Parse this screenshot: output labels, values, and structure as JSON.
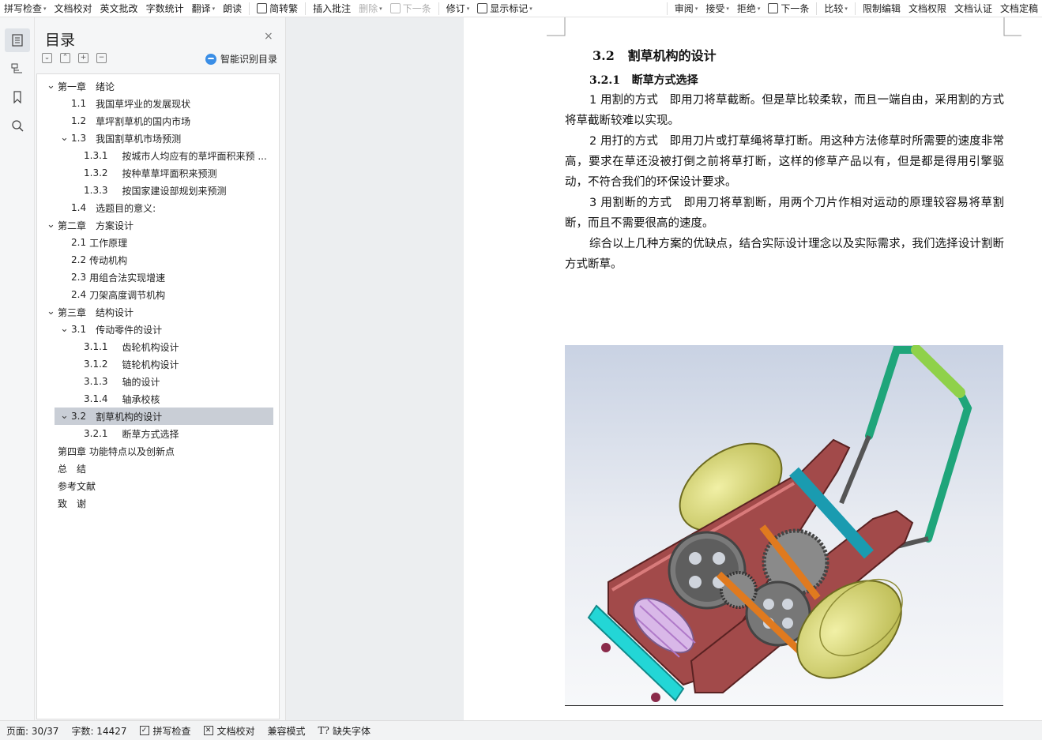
{
  "ribbon": {
    "items": [
      {
        "label": "拼写检查",
        "caret": true,
        "disabled": false
      },
      {
        "label": "文档校对",
        "caret": false,
        "disabled": false
      },
      {
        "label": "英文批改",
        "caret": false,
        "disabled": false
      },
      {
        "label": "字数统计",
        "caret": false,
        "disabled": false
      },
      {
        "label": "翻译",
        "caret": true,
        "disabled": false
      },
      {
        "label": "朗读",
        "caret": false,
        "disabled": false
      },
      {
        "label": "简转繁",
        "caret": false,
        "disabled": false
      },
      {
        "label": "插入批注",
        "caret": false,
        "disabled": false
      },
      {
        "label": "删除",
        "caret": true,
        "disabled": true
      },
      {
        "label": "下一条",
        "caret": false,
        "disabled": true
      },
      {
        "label": "修订",
        "caret": true,
        "disabled": false
      },
      {
        "label": "显示标记",
        "caret": true,
        "disabled": false
      },
      {
        "label": "审阅",
        "caret": true,
        "disabled": false
      },
      {
        "label": "接受",
        "caret": true,
        "disabled": false
      },
      {
        "label": "拒绝",
        "caret": true,
        "disabled": false
      },
      {
        "label": "下一条",
        "caret": false,
        "disabled": false
      },
      {
        "label": "比较",
        "caret": true,
        "disabled": false
      },
      {
        "label": "限制编辑",
        "caret": false,
        "disabled": false
      },
      {
        "label": "文档权限",
        "caret": false,
        "disabled": false
      },
      {
        "label": "文档认证",
        "caret": false,
        "disabled": false
      },
      {
        "label": "文档定稿",
        "caret": false,
        "disabled": false
      }
    ]
  },
  "rail": {
    "icons": [
      "toc-icon",
      "outline-icon",
      "bookmark-icon",
      "search-icon"
    ]
  },
  "toc": {
    "title": "目录",
    "close": "×",
    "tools": [
      "expand-icon",
      "collapse-icon",
      "add-icon",
      "remove-icon"
    ],
    "smart_label": "智能识别目录",
    "items": [
      {
        "num": "第一章",
        "text": "绪论",
        "level": 0,
        "arrow": true,
        "selected": false
      },
      {
        "num": "1.1",
        "text": "我国草坪业的发展现状",
        "level": 1,
        "arrow": false,
        "selected": false
      },
      {
        "num": "1.2",
        "text": "草坪割草机的国内市场",
        "level": 1,
        "arrow": false,
        "selected": false
      },
      {
        "num": "1.3",
        "text": "我国割草机市场预测",
        "level": 1,
        "arrow": true,
        "selected": false
      },
      {
        "num": "1.3.1",
        "text": "按城市人均应有的草坪面积来预 ...",
        "level": 2,
        "arrow": false,
        "selected": false
      },
      {
        "num": "1.3.2",
        "text": "按种草草坪面积来预测",
        "level": 2,
        "arrow": false,
        "selected": false
      },
      {
        "num": "1.3.3",
        "text": "按国家建设部规划来预测",
        "level": 2,
        "arrow": false,
        "selected": false
      },
      {
        "num": "1.4",
        "text": "选题目的意义:",
        "level": 1,
        "arrow": false,
        "selected": false
      },
      {
        "num": "第二章",
        "text": "方案设计",
        "level": 0,
        "arrow": true,
        "selected": false
      },
      {
        "num": "2.1",
        "text": "工作原理",
        "level": 1,
        "arrow": false,
        "selected": false,
        "tight": true
      },
      {
        "num": "2.2",
        "text": "传动机构",
        "level": 1,
        "arrow": false,
        "selected": false,
        "tight": true
      },
      {
        "num": "2.3",
        "text": "用组合法实现增速",
        "level": 1,
        "arrow": false,
        "selected": false,
        "tight": true
      },
      {
        "num": "2.4",
        "text": "刀架高度调节机构",
        "level": 1,
        "arrow": false,
        "selected": false,
        "tight": true
      },
      {
        "num": "第三章",
        "text": "结构设计",
        "level": 0,
        "arrow": true,
        "selected": false
      },
      {
        "num": "3.1",
        "text": "传动零件的设计",
        "level": 1,
        "arrow": true,
        "selected": false
      },
      {
        "num": "3.1.1",
        "text": "齿轮机构设计",
        "level": 2,
        "arrow": false,
        "selected": false
      },
      {
        "num": "3.1.2",
        "text": "链轮机构设计",
        "level": 2,
        "arrow": false,
        "selected": false
      },
      {
        "num": "3.1.3",
        "text": "轴的设计",
        "level": 2,
        "arrow": false,
        "selected": false
      },
      {
        "num": "3.1.4",
        "text": "轴承校核",
        "level": 2,
        "arrow": false,
        "selected": false
      },
      {
        "num": "3.2",
        "text": "割草机构的设计",
        "level": 1,
        "arrow": true,
        "selected": true
      },
      {
        "num": "3.2.1",
        "text": "断草方式选择",
        "level": 2,
        "arrow": false,
        "selected": false
      },
      {
        "num": "第四章",
        "text": "功能特点以及创新点",
        "level": 0,
        "arrow": false,
        "selected": false,
        "tight": true
      },
      {
        "num": "总",
        "text": "结",
        "level": 0,
        "arrow": false,
        "selected": false
      },
      {
        "num": "参考文献",
        "text": "",
        "level": 0,
        "arrow": false,
        "selected": false
      },
      {
        "num": "致",
        "text": "谢",
        "level": 0,
        "arrow": false,
        "selected": false
      }
    ]
  },
  "doc": {
    "h2_num": "3.2",
    "h2_text": "割草机构的设计",
    "h3_num": "3.2.1",
    "h3_text": "断草方式选择",
    "paragraphs": [
      "1 用割的方式　即用刀将草截断。但是草比较柔软，而且一端自由，采用割的方式将草截断较难以实现。",
      "2 用打的方式　即用刀片或打草绳将草打断。用这种方法修草时所需要的速度非常高，要求在草还没被打倒之前将草打断，这样的修草产品以有，但是都是得用引擎驱动，不符合我们的环保设计要求。",
      "3 用割断的方式　即用刀将草割断，用两个刀片作相对运动的原理较容易将草割断，而且不需要很高的速度。",
      "综合以上几种方案的优缺点，结合实际设计理念以及实际需求，我们选择设计割断方式断草。"
    ],
    "figure_icon": "lawn-mower-3d-model"
  },
  "status": {
    "page": "页面: 30/37",
    "words": "字数: 14427",
    "spell": "拼写检查",
    "proof": "文档校对",
    "compat": "兼容模式",
    "missing_font": "缺失字体"
  },
  "colors": {
    "selected_row": "#c9ced6",
    "panel_bg": "#f5f6f7",
    "doc_bg": "#eceef0",
    "accent": "#3a8ee6"
  }
}
